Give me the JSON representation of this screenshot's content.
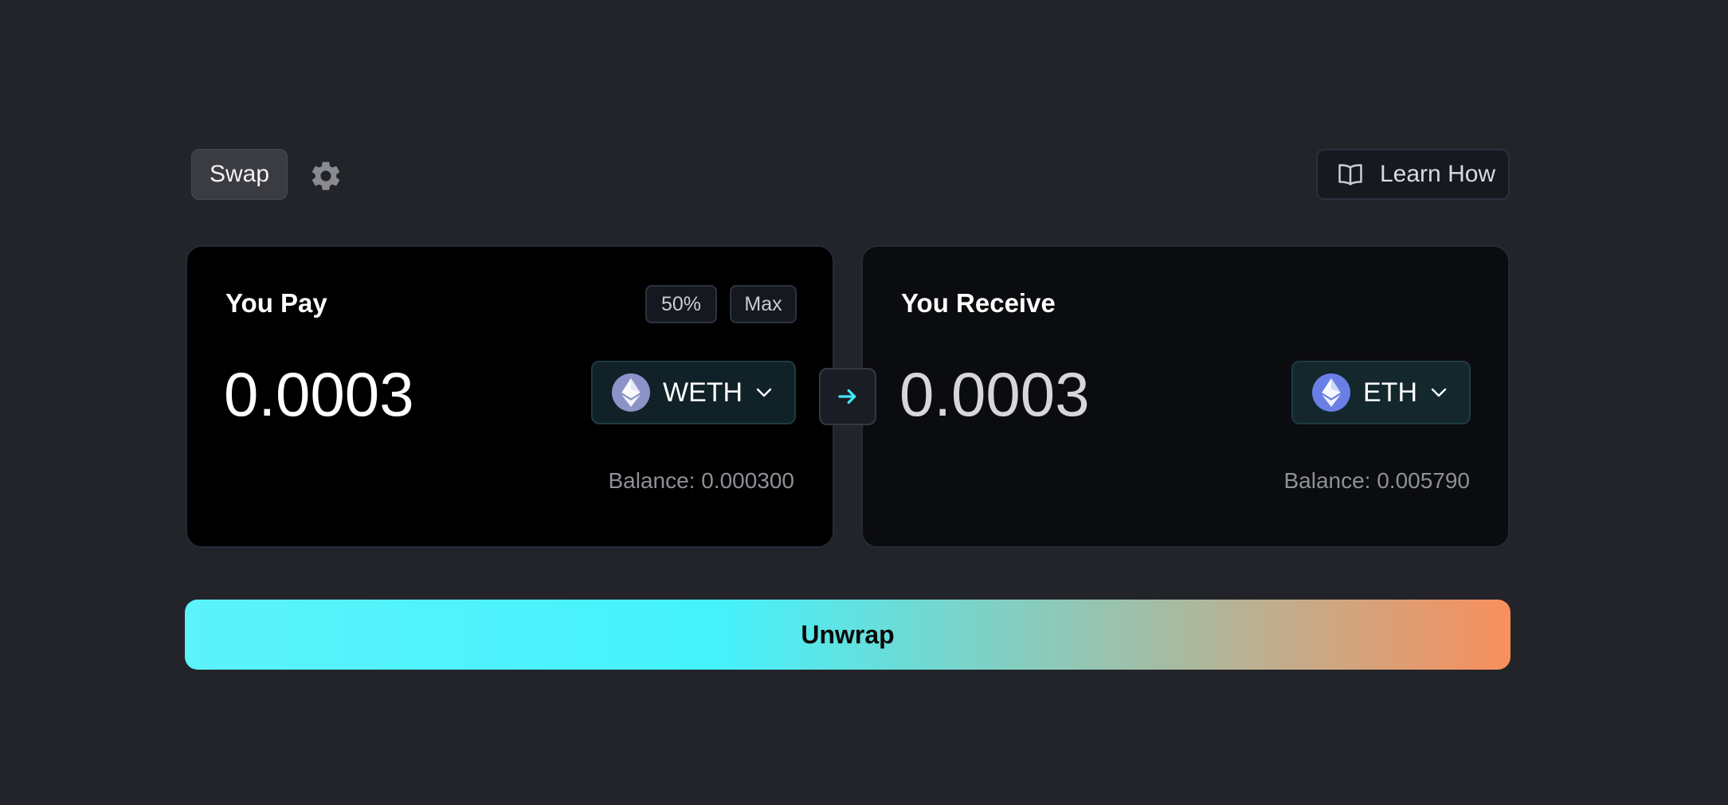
{
  "header": {
    "swap_tab": "Swap",
    "settings_icon": "gear-icon",
    "learn_how": "Learn How",
    "learn_icon": "book-icon"
  },
  "pay": {
    "title": "You Pay",
    "half_button": "50%",
    "max_button": "Max",
    "amount": "0.0003",
    "token": "WETH",
    "balance": "Balance: 0.000300"
  },
  "receive": {
    "title": "You Receive",
    "amount": "0.0003",
    "token": "ETH",
    "balance": "Balance: 0.005790"
  },
  "action": {
    "label": "Unwrap"
  },
  "colors": {
    "background": "#23242a",
    "accent_cyan": "#44f2fc",
    "accent_orange": "#f98f5d"
  }
}
